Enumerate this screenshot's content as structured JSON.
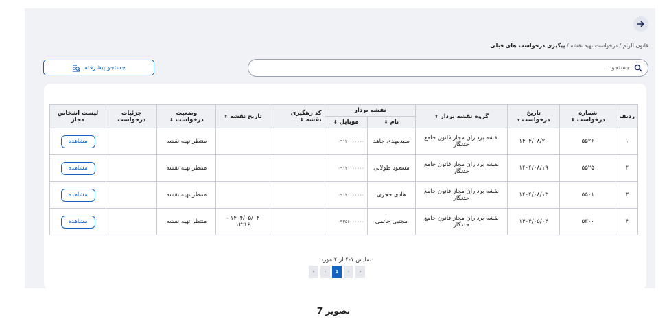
{
  "breadcrumb": {
    "item1": "قانون الزام",
    "sep1": " / ",
    "item2": "درخواست تهیه نقشه",
    "sep2": " / ",
    "current": "پیگیری درخواست های قبلی"
  },
  "search": {
    "placeholder": "جستجو ..."
  },
  "advanced_search": {
    "label": "جستجو پیشرفته"
  },
  "table": {
    "headers": {
      "row": "ردیف",
      "request_number": "شماره درخواست",
      "request_date": "تاریخ درخواست",
      "group": "گروه نقشه بردار",
      "surveyor": "نقشه بردار",
      "name": "نام",
      "mobile": "موبایل",
      "tracking": "کد رهگیری نقشه",
      "map_date": "تاریخ نقشه",
      "status": "وضعیت درخواست",
      "details": "جزئیات درخواست",
      "authorized": "لیست اشخاص مجاز"
    },
    "sort_icon": "⬍",
    "rows": [
      {
        "row": "۱",
        "request_number": "۵۵۲۶",
        "request_date": "۱۴۰۴/۰۸/۲۰",
        "group": "نقشه برداران مجاز قانون جامع حدنگار",
        "name": "سیدمهدی جاهد",
        "mobile": "۰۹۱۲۰۰۰۰۰۰۰",
        "tracking": "",
        "map_date": "",
        "status": "منتظر تهیه نقشه",
        "details": "",
        "action": "مشاهده"
      },
      {
        "row": "۲",
        "request_number": "۵۵۲۵",
        "request_date": "۱۴۰۴/۰۸/۱۹",
        "group": "نقشه برداران مجاز قانون جامع حدنگار",
        "name": "مسعود طولابی",
        "mobile": "۰۹۱۲۰۰۰۰۰۰۰",
        "tracking": "",
        "map_date": "",
        "status": "منتظر تهیه نقشه",
        "details": "",
        "action": "مشاهده"
      },
      {
        "row": "۳",
        "request_number": "۵۵۰۱",
        "request_date": "۱۴۰۴/۰۸/۱۳",
        "group": "نقشه برداران مجاز قانون جامع حدنگار",
        "name": "هادی حجری",
        "mobile": "۰۹۱۲۰۰۰۰۰۰۰",
        "tracking": "",
        "map_date": "",
        "status": "منتظر تهیه نقشه",
        "details": "",
        "action": "مشاهده"
      },
      {
        "row": "۴",
        "request_number": "۵۳۰۰",
        "request_date": "۱۴۰۴/۰۵/۰۴",
        "group": "نقشه برداران مجاز قانون جامع حدنگار",
        "name": "مجتبی خاتمی",
        "mobile": "۰۹۳۵۶۰۰۰۰۰۰",
        "tracking": "",
        "map_date": "۱۴۰۴/۰۵/۰۴ - ۱۲:۱۶",
        "status": "منتظر تهیه نقشه",
        "details": "",
        "action": "مشاهده"
      }
    ]
  },
  "summary": "نمایش ۱-۴ از ۴ مورد.",
  "pagination": {
    "first": "«",
    "prev": "‹",
    "current": "1",
    "next": "›",
    "last": "»"
  },
  "caption": "تصویر 7",
  "colors": {
    "primary": "#1565c0",
    "background": "#f1f2f6",
    "header_bg": "#eef0f4"
  }
}
